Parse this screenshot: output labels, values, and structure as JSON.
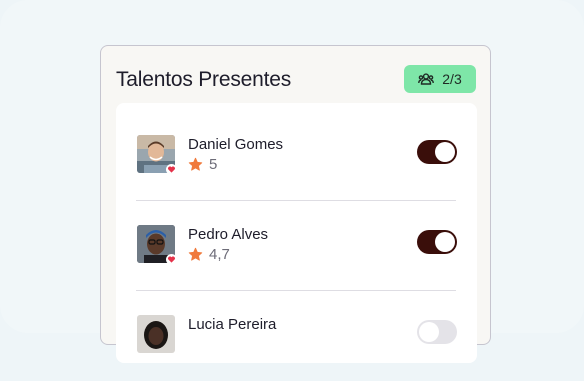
{
  "card": {
    "title": "Talentos Presentes",
    "badge_count": "2/3",
    "badge_icon": "group-icon"
  },
  "talents": [
    {
      "name": "Daniel Gomes",
      "rating": "5",
      "present": true
    },
    {
      "name": "Pedro Alves",
      "rating": "4,7",
      "present": true
    },
    {
      "name": "Lucia Pereira",
      "rating": "",
      "present": false
    }
  ],
  "colors": {
    "badge_bg": "#7ee6a8",
    "toggle_on": "#3a0e0a",
    "star": "#f07a3c",
    "heart": "#e5334b"
  }
}
